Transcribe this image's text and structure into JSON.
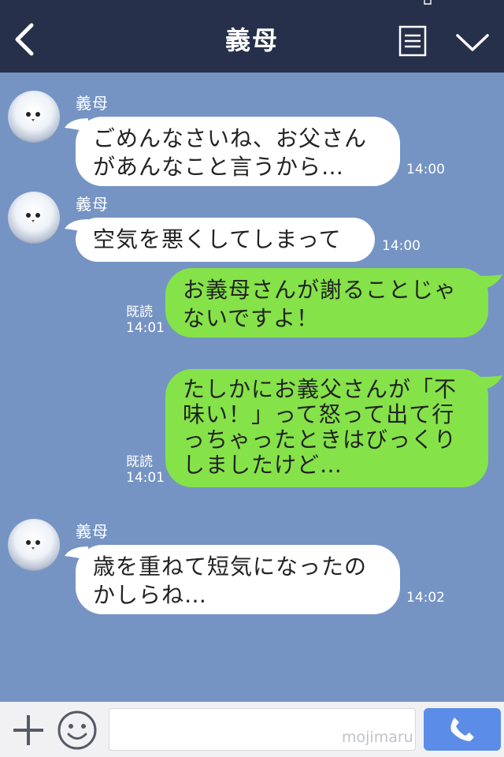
{
  "header": {
    "title": "義母"
  },
  "messages": [
    {
      "sender": "義母",
      "direction": "in",
      "text": "ごめんなさいね、お父さん\nがあんなこと言うから…",
      "time": "14:00"
    },
    {
      "sender": "義母",
      "direction": "in",
      "text": "空気を悪くしてしまって",
      "time": "14:00"
    },
    {
      "direction": "out",
      "text": "お義母さんが謝ることじゃ\nないですよ！",
      "read": "既読",
      "time": "14:01"
    },
    {
      "direction": "out",
      "text": "たしかにお義父さんが「不\n味い！」って怒って出て行\nっちゃったときはびっくり\nしましたけど…",
      "read": "既読",
      "time": "14:01"
    },
    {
      "sender": "義母",
      "direction": "in",
      "text": "歳を重ねて短気になったの\nかしらね…",
      "time": "14:02"
    }
  ],
  "input": {
    "value": "",
    "watermark": "mojimaru"
  },
  "colors": {
    "background": "#7594c4",
    "header": "#27304a",
    "outgoing": "#85e249",
    "incoming": "#ffffff",
    "call": "#5b8de8"
  },
  "icons": [
    "back-arrow-icon",
    "menu-icon",
    "chevron-down-icon",
    "plus-icon",
    "smile-icon",
    "phone-icon"
  ]
}
